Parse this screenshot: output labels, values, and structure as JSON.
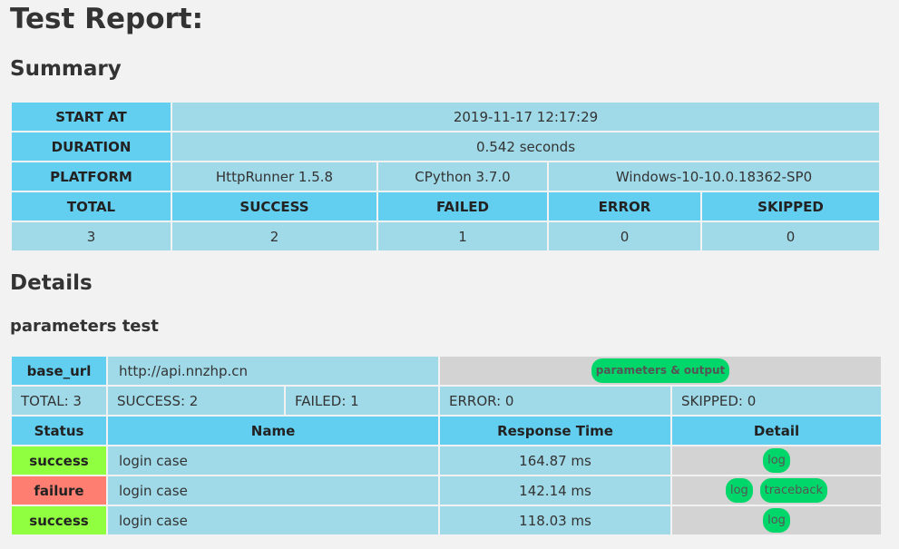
{
  "title": "Test Report:",
  "summary_heading": "Summary",
  "summary": {
    "start_at_label": "START AT",
    "start_at": "2019-11-17 12:17:29",
    "duration_label": "DURATION",
    "duration": "0.542 seconds",
    "platform_label": "PLATFORM",
    "platform": [
      "HttpRunner 1.5.8",
      "CPython 3.7.0",
      "Windows-10-10.0.18362-SP0"
    ],
    "stat_headers": [
      "TOTAL",
      "SUCCESS",
      "FAILED",
      "ERROR",
      "SKIPPED"
    ],
    "stat_values": [
      "3",
      "2",
      "1",
      "0",
      "0"
    ]
  },
  "details_heading": "Details",
  "suite": {
    "name": "parameters test",
    "base_url_label": "base_url",
    "base_url": "http://api.nnzhp.cn",
    "params_button": "parameters & output",
    "counts": {
      "total": "TOTAL: 3",
      "success": "SUCCESS: 2",
      "failed": "FAILED: 1",
      "error": "ERROR: 0",
      "skipped": "SKIPPED: 0"
    },
    "columns": [
      "Status",
      "Name",
      "Response Time",
      "Detail"
    ],
    "rows": [
      {
        "status": "success",
        "name": "login case",
        "time": "164.87 ms",
        "log": "log"
      },
      {
        "status": "failure",
        "name": "login case",
        "time": "142.14 ms",
        "log": "log",
        "traceback": "traceback"
      },
      {
        "status": "success",
        "name": "login case",
        "time": "118.03 ms",
        "log": "log"
      }
    ]
  },
  "colors": {
    "header_cell": "#62cff0",
    "value_cell": "#a0dae8",
    "success": "#90ff3f",
    "failure": "#ff7e72",
    "pill": "#00d76a"
  }
}
